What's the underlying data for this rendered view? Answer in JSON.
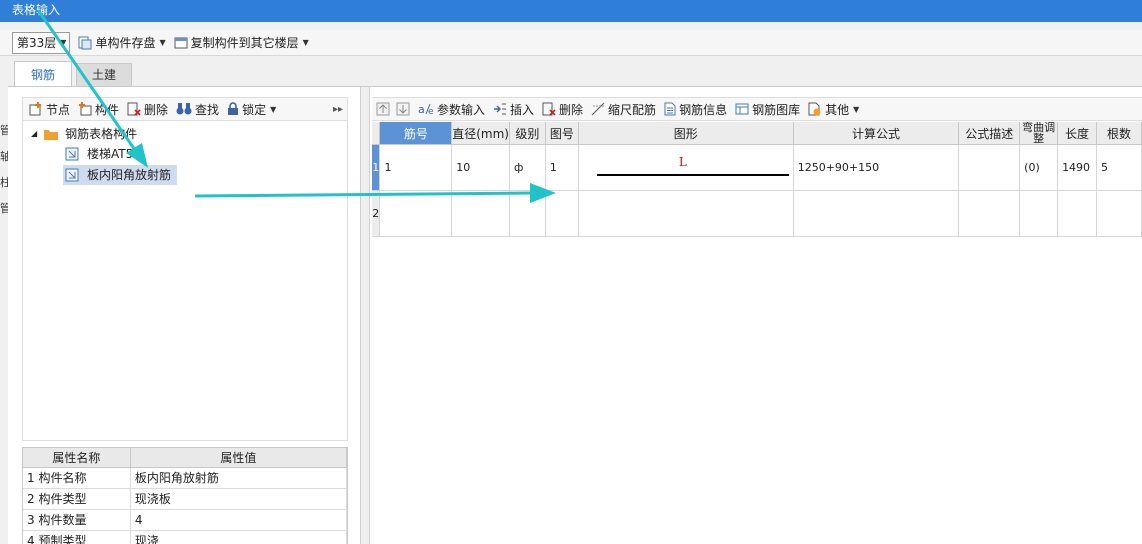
{
  "window": {
    "title": "表格输入"
  },
  "toolbar": {
    "floor": "第33层",
    "save_component": "单构件存盘",
    "copy_to_floor": "复制构件到其它楼层"
  },
  "tabs": [
    "钢筋",
    "土建"
  ],
  "left_strip": [
    "管",
    "轴",
    "柱",
    "管",
    "门"
  ],
  "left_toolbar": {
    "node": "节点",
    "component": "构件",
    "delete": "删除",
    "find": "查找",
    "lock": "锁定"
  },
  "tree": {
    "root": "钢筋表格构件",
    "children": [
      "楼梯AT5",
      "板内阳角放射筋"
    ]
  },
  "properties": {
    "headers": [
      "属性名称",
      "属性值"
    ],
    "rows": [
      {
        "num": "1",
        "name": "构件名称",
        "value": "板内阳角放射筋"
      },
      {
        "num": "2",
        "name": "构件类型",
        "value": "现浇板"
      },
      {
        "num": "3",
        "name": "构件数量",
        "value": "4"
      },
      {
        "num": "4",
        "name": "预制类型",
        "value": "现浇"
      }
    ]
  },
  "right_toolbar": {
    "param_input": "参数输入",
    "insert": "插入",
    "delete": "删除",
    "scale_rebar": "缩尺配筋",
    "rebar_info": "钢筋信息",
    "rebar_library": "钢筋图库",
    "other": "其他"
  },
  "grid": {
    "headers": [
      "筋号",
      "直径(mm)",
      "级别",
      "图号",
      "图形",
      "计算公式",
      "公式描述",
      "弯曲调整",
      "长度",
      "根数"
    ],
    "rows": [
      {
        "num": "1",
        "bar_no": "1",
        "diameter": "10",
        "grade": "ф",
        "figure_no": "1",
        "shape_label": "L",
        "formula": "1250+90+150",
        "formula_desc": "",
        "bend_adjust": "(0)",
        "length": "1490",
        "count": "5"
      },
      {
        "num": "2",
        "bar_no": "",
        "diameter": "",
        "grade": "",
        "figure_no": "",
        "shape_label": "",
        "formula": "",
        "formula_desc": "",
        "bend_adjust": "",
        "length": "",
        "count": ""
      }
    ]
  },
  "colors": {
    "titlebar": "#2f7fd8",
    "header_highlight": "#5b93d6",
    "annotation_arrow": "#22c3c8",
    "shape_label": "#d01010"
  }
}
